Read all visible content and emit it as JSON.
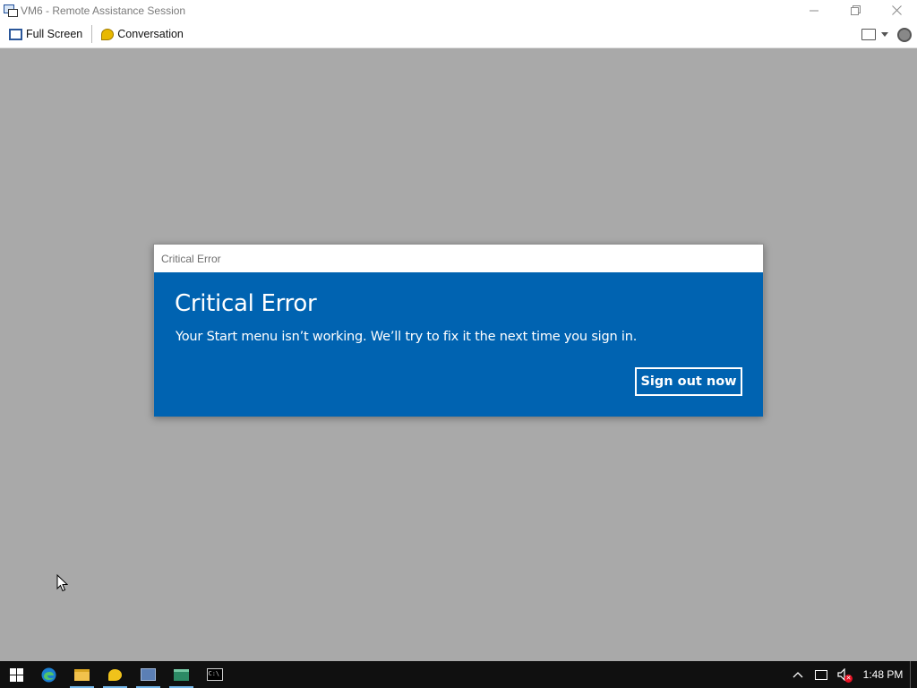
{
  "window": {
    "title": "VM6 - Remote Assistance Session",
    "controls": [
      "minimize",
      "restore",
      "close"
    ]
  },
  "toolbar": {
    "full_screen_label": "Full Screen",
    "conversation_label": "Conversation",
    "icons": [
      "full-screen-icon",
      "conversation-icon",
      "display-settings-icon",
      "help-icon"
    ]
  },
  "dialog": {
    "window_title": "Critical Error",
    "heading": "Critical Error",
    "message": "Your Start menu isn’t working. We’ll try to fix it the next time you sign in.",
    "button_label": "Sign out now",
    "colors": {
      "body_bg": "#0063b1",
      "text": "#ffffff"
    }
  },
  "taskbar": {
    "items": [
      {
        "name": "start",
        "icon": "windows-logo-icon"
      },
      {
        "name": "edge",
        "icon": "edge-icon"
      },
      {
        "name": "file-explorer",
        "icon": "folder-icon"
      },
      {
        "name": "conversation",
        "icon": "chat-bubble-icon"
      },
      {
        "name": "remote-assistance",
        "icon": "remote-assistance-icon"
      },
      {
        "name": "network-app",
        "icon": "network-app-icon"
      },
      {
        "name": "command-prompt",
        "icon": "cmd-icon",
        "glyph": "C:\\"
      }
    ],
    "tray": {
      "clock": "1:48 PM"
    }
  },
  "desktop": {
    "background": "#a9a9a9"
  }
}
